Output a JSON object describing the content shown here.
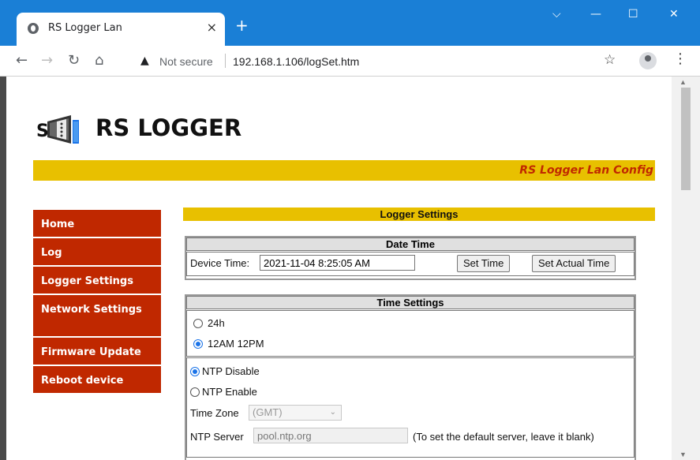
{
  "browser": {
    "tab_title": "RS Logger Lan",
    "tab_close": "×",
    "new_tab": "+",
    "window_minimize": "—",
    "window_maximize": "☐",
    "window_close": "✕",
    "window_dropdown": "⌵",
    "security_label": "Not secure",
    "url": "192.168.1.106/logSet.htm"
  },
  "header": {
    "brand": "RS LOGGER",
    "banner": "RS Logger Lan Config"
  },
  "nav": {
    "items": [
      {
        "label": "Home"
      },
      {
        "label": "Log"
      },
      {
        "label": "Logger Settings"
      },
      {
        "label": "Network Settings"
      },
      {
        "label": "Firmware Update"
      },
      {
        "label": "Reboot device"
      }
    ]
  },
  "main": {
    "title": "Logger Settings",
    "date_time": {
      "heading": "Date Time",
      "device_time_label": "Device Time:",
      "device_time_value": "2021-11-04  8:25:05 AM",
      "set_time_button": "Set Time",
      "set_actual_time_button": "Set Actual Time"
    },
    "time_settings": {
      "heading": "Time Settings",
      "format_24h": "24h",
      "format_12h": "12AM 12PM",
      "format_selected": "12AM 12PM",
      "ntp_disable": "NTP Disable",
      "ntp_enable": "NTP Enable",
      "ntp_selected": "NTP Disable",
      "time_zone_label": "Time Zone",
      "time_zone_value": "(GMT)",
      "ntp_server_label": "NTP Server",
      "ntp_server_placeholder": "pool.ntp.org",
      "ntp_server_hint": "(To set the default server, leave it blank)"
    }
  },
  "colors": {
    "titlebar": "#1a7fd6",
    "nav_bg": "#c02800",
    "banner_bg": "#e8c000",
    "banner_text": "#c02800",
    "radio_checked": "#1a73e8"
  },
  "icons": [
    "globe-icon",
    "back-arrow-icon",
    "forward-arrow-icon",
    "reload-icon",
    "home-icon",
    "warning-icon",
    "star-icon",
    "profile-icon",
    "menu-dots-icon",
    "serial-logger-logo"
  ]
}
